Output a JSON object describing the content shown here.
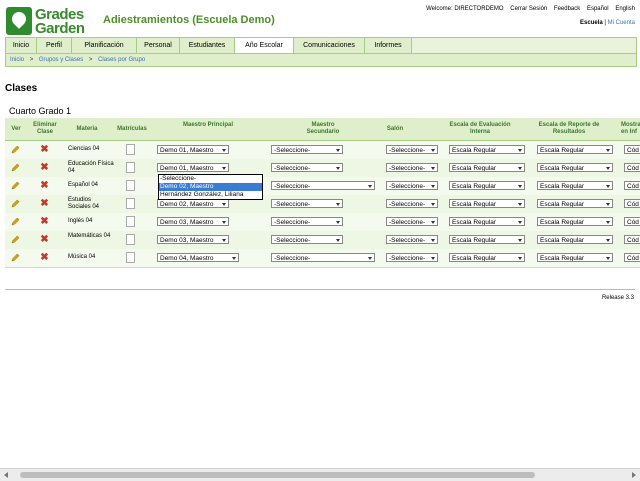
{
  "header": {
    "logo_line1": "Grades",
    "logo_line2": "Garden",
    "school_title": "Adiestramientos (Escuela Demo)",
    "welcome": "Welcome: DIRECTORDEMO",
    "logout": "Cerrar Sesión",
    "feedback": "Feedback",
    "lang_es": "Español",
    "lang_en": "English",
    "school_selected": "Escuela",
    "school_sep": "|",
    "school_other": "Mi Cuenta"
  },
  "tabs": [
    "Inicio",
    "Perfil",
    "Planificación",
    "Personal",
    "Estudiantes",
    "Año Escolar",
    "Comunicaciones",
    "Informes"
  ],
  "active_tab": "Año Escolar",
  "breadcrumb": [
    "Inicio",
    "Grupos y Clases",
    "Clases por Grupo"
  ],
  "breadcrumb_sep": ">",
  "page_title": "Clases",
  "group_title": "Cuarto Grado 1",
  "columns": {
    "ver": "Ver",
    "eliminar": "Eliminar Clase",
    "materia": "Materia",
    "matriculas": "Matrículas",
    "maestro_principal": "Maestro Principal",
    "maestro_secundario": "Maestro Secundario",
    "salon": "Salón",
    "escala_interna": "Escala de Evaluación Interna",
    "escala_reporte": "Escala de Reporte de Resultados",
    "mostrar": "Mostrar en Inf"
  },
  "rows": [
    {
      "materia": "Ciencias 04",
      "maestro": "Demo 01, Maestro",
      "secundario": "-Seleccione-",
      "salon": "-Seleccione-",
      "escala_interna": "Escala Regular",
      "escala_reporte": "Escala Regular",
      "mostrar": "Cód"
    },
    {
      "materia": "Educación Física 04",
      "maestro": "Demo 01, Maestro",
      "secundario": "-Seleccione-",
      "salon": "-Seleccione-",
      "escala_interna": "Escala Regular",
      "escala_reporte": "Escala Regular",
      "mostrar": "Cód"
    },
    {
      "materia": "Español 04",
      "maestro": "",
      "secundario": "-Seleccione-",
      "salon": "-Seleccione-",
      "escala_interna": "Escala Regular",
      "escala_reporte": "Escala Regular",
      "mostrar": "Cód"
    },
    {
      "materia": "Estudios Sociales 04",
      "maestro": "Demo 02, Maestro",
      "secundario": "-Seleccione-",
      "salon": "-Seleccione-",
      "escala_interna": "Escala Regular",
      "escala_reporte": "Escala Regular",
      "mostrar": "Cód"
    },
    {
      "materia": "Inglés 04",
      "maestro": "Demo 03, Maestro",
      "secundario": "-Seleccione-",
      "salon": "-Seleccione-",
      "escala_interna": "Escala Regular",
      "escala_reporte": "Escala Regular",
      "mostrar": "Cód"
    },
    {
      "materia": "Matemáticas 04",
      "maestro": "Demo 03, Maestro",
      "secundario": "-Seleccione-",
      "salon": "-Seleccione-",
      "escala_interna": "Escala Regular",
      "escala_reporte": "Escala Regular",
      "mostrar": "Cód"
    },
    {
      "materia": "Música 04",
      "maestro": "Demo 04, Maestro",
      "secundario": "-Seleccione-",
      "salon": "-Seleccione-",
      "escala_interna": "Escala Regular",
      "escala_reporte": "Escala Regular",
      "mostrar": "Cód"
    }
  ],
  "dropdown_options": [
    "-Seleccione-",
    "Demo 02, Maestro",
    "Hernández González, Liliana"
  ],
  "dropdown_highlight": "Demo 02, Maestro",
  "release": "Release 3.3",
  "colors": {
    "brand_green": "#3a8a2e",
    "tab_bg": "#dfeecb",
    "delete_red": "#c0392b",
    "highlight_blue": "#3a7bd5"
  }
}
